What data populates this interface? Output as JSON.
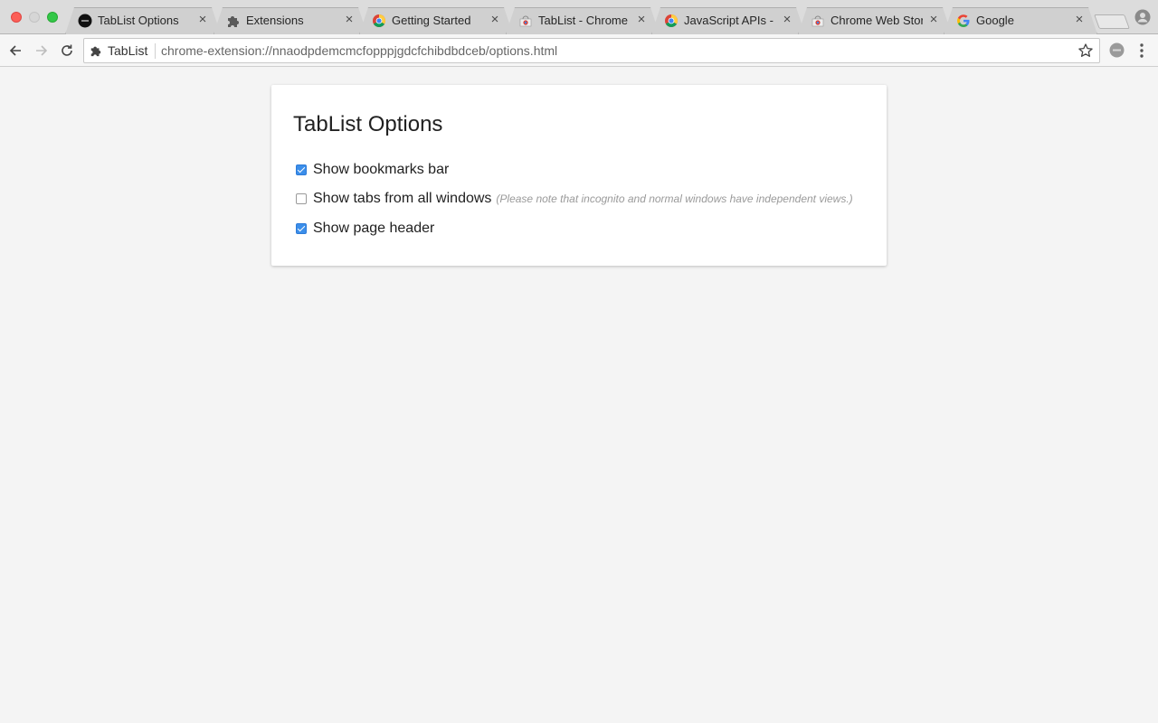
{
  "window": {
    "tabs": [
      {
        "title": "TabList Options",
        "icon": "tablist-logo-icon",
        "active": true
      },
      {
        "title": "Extensions",
        "icon": "puzzle-icon",
        "active": false
      },
      {
        "title": "Getting Started",
        "icon": "chrome-icon",
        "active": false
      },
      {
        "title": "TabList - Chrome W",
        "icon": "web-store-icon",
        "active": false
      },
      {
        "title": "JavaScript APIs - G",
        "icon": "chrome-icon",
        "active": false
      },
      {
        "title": "Chrome Web Store",
        "icon": "web-store-icon",
        "active": false
      },
      {
        "title": "Google",
        "icon": "google-icon",
        "active": false
      }
    ],
    "close_glyph": "×"
  },
  "toolbar": {
    "chip_label": "TabList",
    "url": "chrome-extension://nnaodpdemcmcfopppjgdcfchibdbdceb/options.html"
  },
  "options": {
    "title": "TabList Options",
    "items": [
      {
        "label": "Show bookmarks bar",
        "checked": true,
        "note": ""
      },
      {
        "label": "Show tabs from all windows",
        "checked": false,
        "note": "(Please note that incognito and normal windows have independent views.)"
      },
      {
        "label": "Show page header",
        "checked": true,
        "note": ""
      }
    ]
  },
  "colors": {
    "checkbox_accent": "#3b8eea",
    "page_background": "#f4f4f4"
  }
}
